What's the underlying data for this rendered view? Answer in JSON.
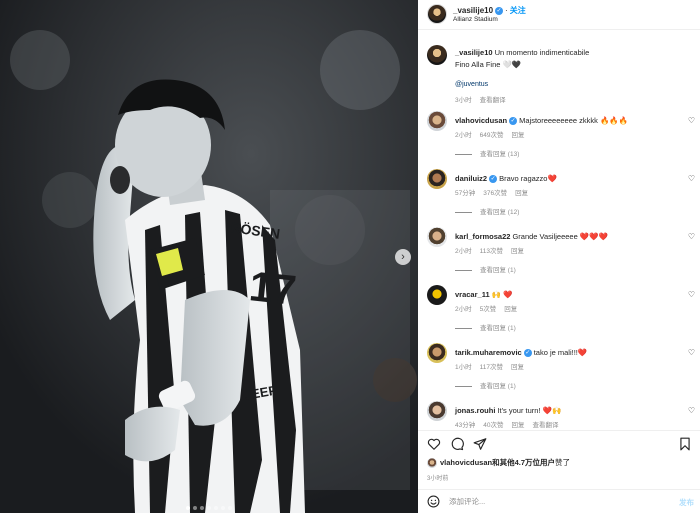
{
  "post": {
    "username": "_vasilije10",
    "follow_label": "关注",
    "location": "Allianz Stadium",
    "caption_line1": "Un momento indimenticabile",
    "caption_line2": "Fino Alla Fine 🤍🖤",
    "caption_tag": "@juventus",
    "caption_time": "3小时",
    "see_translation": "查看翻译"
  },
  "comments": [
    {
      "user": "vlahovicdusan",
      "verified": true,
      "text": "Majstoreeeeeeee zkkkk 🔥🔥🔥",
      "time": "2小时",
      "likes": "649次赞",
      "reply": "回复",
      "view_replies": "查看回复 (13)"
    },
    {
      "user": "daniluiz2",
      "verified": true,
      "text": "Bravo ragazzo❤️",
      "time": "57分钟",
      "likes": "376次赞",
      "reply": "回复",
      "view_replies": "查看回复 (12)"
    },
    {
      "user": "karl_formosa22",
      "verified": false,
      "text": "Grande Vasiljeeeee ❤️❤️❤️",
      "time": "2小时",
      "likes": "113次赞",
      "reply": "回复",
      "view_replies": "查看回复 (1)"
    },
    {
      "user": "vracar_11",
      "verified": false,
      "text": "🙌 ❤️",
      "time": "2小时",
      "likes": "5次赞",
      "reply": "回复",
      "view_replies": "查看回复 (1)"
    },
    {
      "user": "tarik.muharemovic",
      "verified": true,
      "text": "tako je mali!!!❤️",
      "time": "1小时",
      "likes": "117次赞",
      "reply": "回复",
      "view_replies": "查看回复 (1)"
    },
    {
      "user": "jonas.rouhi",
      "verified": false,
      "text": "It's your turn! ❤️🙌",
      "time": "43分钟",
      "likes": "40次赞",
      "reply": "回复",
      "view_replies": "查看翻译"
    }
  ],
  "likes": {
    "user": "vlahovicdusan",
    "rest": "和其他4.7万位用户",
    "suffix": "赞了"
  },
  "post_time": "3小时前",
  "composer": {
    "placeholder": "添加评论...",
    "post_label": "发布"
  },
  "photo": {
    "jersey_name": "RÖSEN",
    "jersey_number": "17",
    "sponsor": "JEEP",
    "slide_count": 7,
    "active_slide": 0
  },
  "icons": [
    "heart-icon",
    "comment-icon",
    "share-icon",
    "bookmark-icon",
    "emoji-icon",
    "chevron-right-icon",
    "verified-icon"
  ]
}
